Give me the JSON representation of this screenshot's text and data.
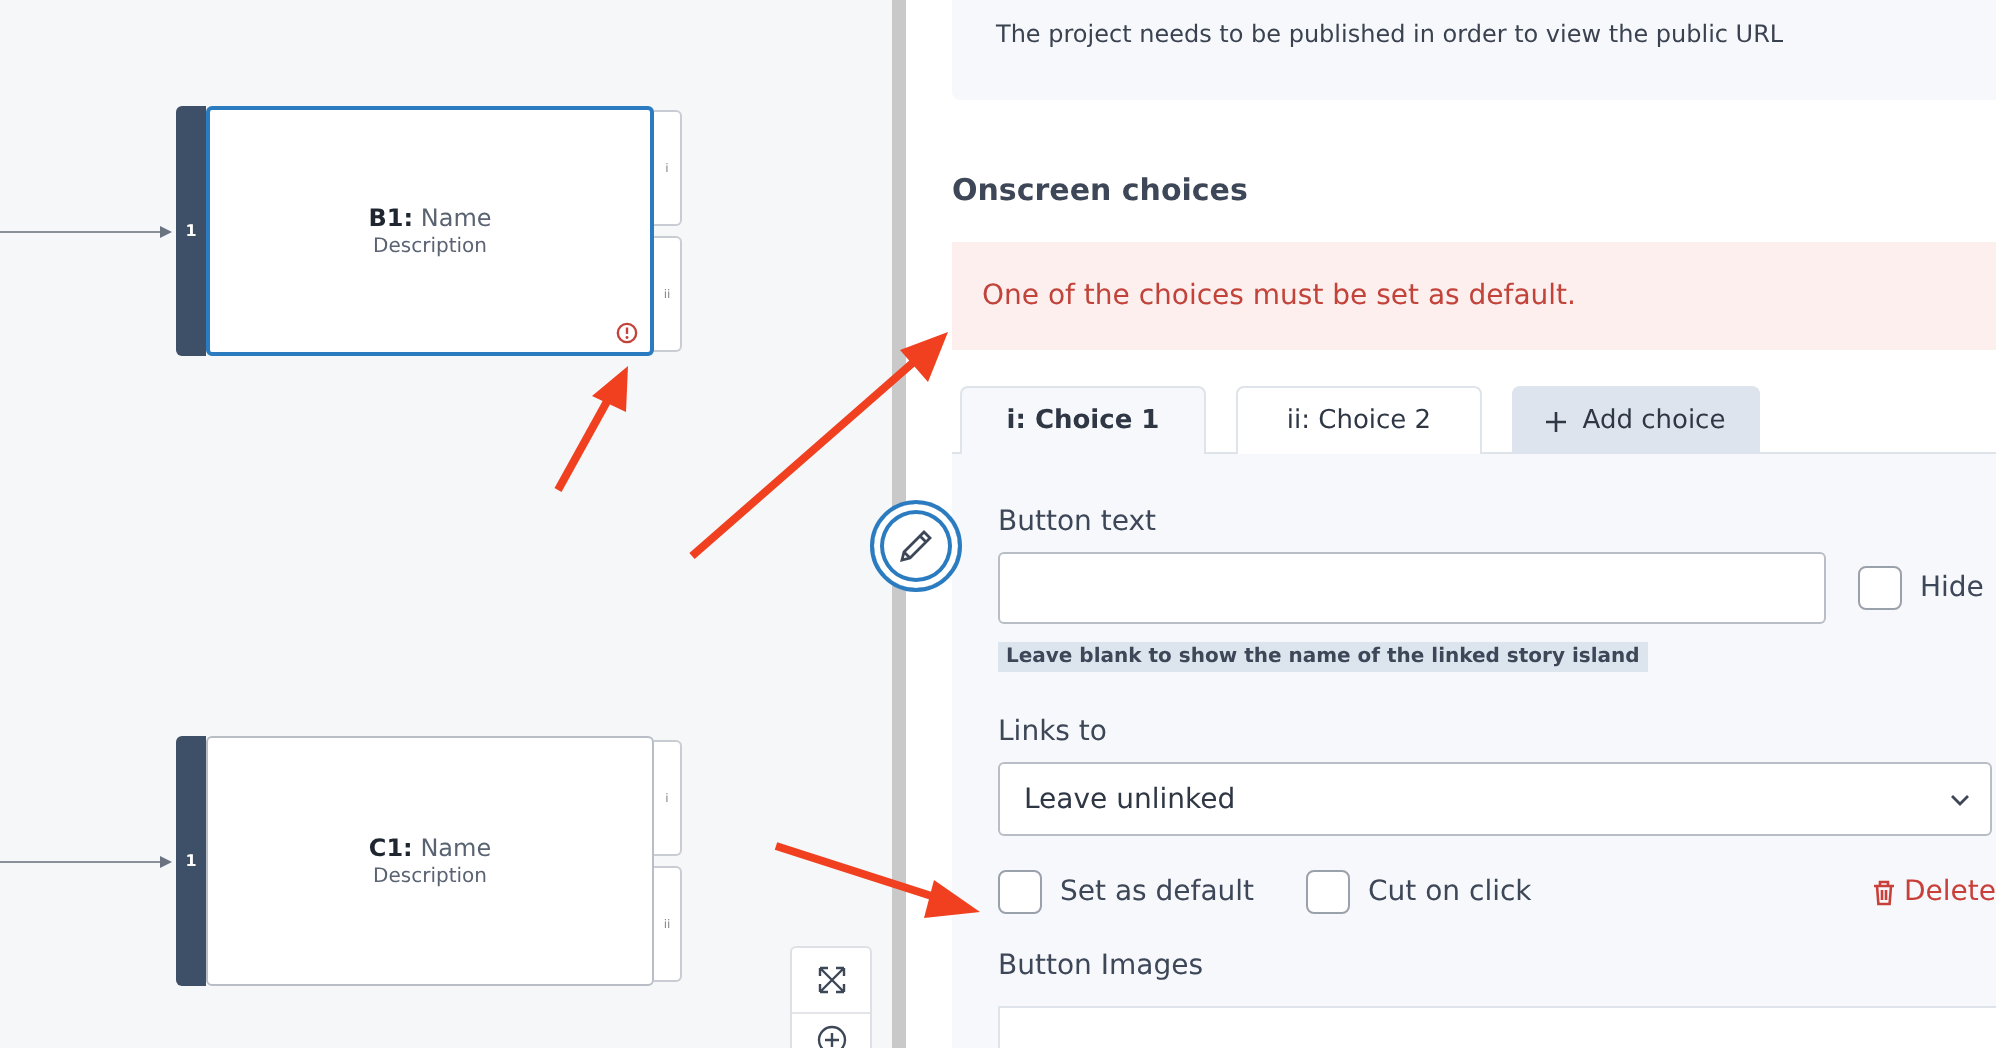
{
  "canvas": {
    "nodes": [
      {
        "code": "B1:",
        "name": "Name",
        "description": "Description",
        "entry": "1",
        "selected": true,
        "warning": true,
        "outputs": [
          "i",
          "ii"
        ]
      },
      {
        "code": "C1:",
        "name": "Name",
        "description": "Description",
        "entry": "1",
        "selected": false,
        "warning": false,
        "outputs": [
          "i",
          "ii"
        ]
      }
    ]
  },
  "panel": {
    "notice": "The project needs to be published in order to view the public URL",
    "section_title": "Onscreen choices",
    "error": "One of the choices must be set as default.",
    "tabs": [
      {
        "kind": "choice",
        "label": "i: Choice 1",
        "selected": true
      },
      {
        "kind": "choice",
        "label": "ii: Choice 2",
        "selected": false
      },
      {
        "kind": "add",
        "label": "Add choice",
        "selected": false
      }
    ],
    "button_text": {
      "label": "Button text",
      "hide": {
        "label": "Hide",
        "checked": false
      },
      "hint": "Leave blank to show the name of the linked story island"
    },
    "links_to": {
      "label": "Links to",
      "value": "Leave unlinked"
    },
    "options": [
      {
        "label": "Set as default",
        "checked": false
      },
      {
        "label": "Cut on click",
        "checked": false
      }
    ],
    "delete": "Delete",
    "images_label": "Button Images"
  }
}
